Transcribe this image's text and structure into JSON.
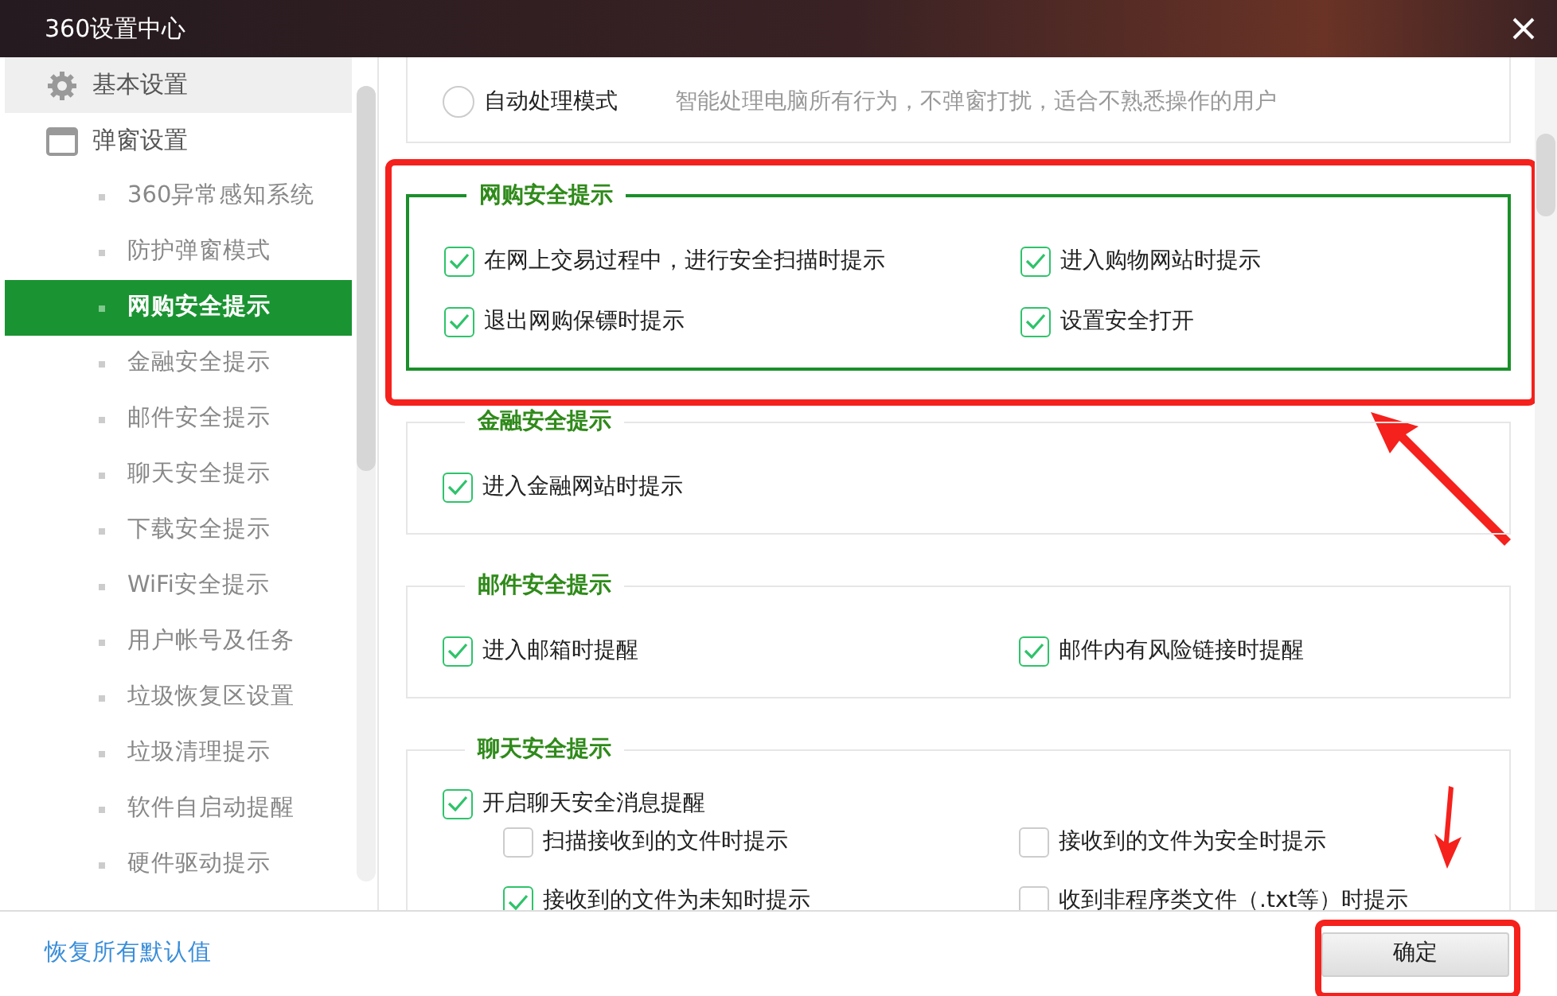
{
  "window": {
    "title": "360设置中心"
  },
  "sidebar": {
    "items": [
      {
        "label": "基本设置",
        "selected": false,
        "hovered": true
      },
      {
        "label": "弹窗设置",
        "selected": false,
        "hovered": false,
        "children": [
          {
            "label": "360异常感知系统",
            "selected": false
          },
          {
            "label": "防护弹窗模式",
            "selected": false
          },
          {
            "label": "网购安全提示",
            "selected": true
          },
          {
            "label": "金融安全提示",
            "selected": false
          },
          {
            "label": "邮件安全提示",
            "selected": false
          },
          {
            "label": "聊天安全提示",
            "selected": false
          },
          {
            "label": "下载安全提示",
            "selected": false
          },
          {
            "label": "WiFi安全提示",
            "selected": false
          },
          {
            "label": "用户帐号及任务",
            "selected": false
          },
          {
            "label": "垃圾恢复区设置",
            "selected": false
          },
          {
            "label": "垃圾清理提示",
            "selected": false
          },
          {
            "label": "软件自启动提醒",
            "selected": false
          },
          {
            "label": "硬件驱动提示",
            "selected": false
          }
        ]
      }
    ]
  },
  "sections": [
    {
      "highlighted": false,
      "options": [
        {
          "kind": "radio",
          "label": "自动处理模式",
          "selected": false,
          "description": "智能处理电脑所有行为，不弹窗打扰，适合不熟悉操作的用户"
        }
      ]
    },
    {
      "legend": "网购安全提示",
      "highlighted": true,
      "options": [
        {
          "kind": "checkbox",
          "label": "在网上交易过程中，进行安全扫描时提示",
          "checked": true
        },
        {
          "kind": "checkbox",
          "label": "进入购物网站时提示",
          "checked": true
        },
        {
          "kind": "checkbox",
          "label": "退出网购保镖时提示",
          "checked": true
        },
        {
          "kind": "checkbox",
          "label": "设置安全打开",
          "checked": true
        }
      ]
    },
    {
      "legend": "金融安全提示",
      "highlighted": false,
      "options": [
        {
          "kind": "checkbox",
          "label": "进入金融网站时提示",
          "checked": true
        }
      ]
    },
    {
      "legend": "邮件安全提示",
      "highlighted": false,
      "options": [
        {
          "kind": "checkbox",
          "label": "进入邮箱时提醒",
          "checked": true
        },
        {
          "kind": "checkbox",
          "label": "邮件内有风险链接时提醒",
          "checked": true
        }
      ]
    },
    {
      "legend": "聊天安全提示",
      "highlighted": false,
      "options": [
        {
          "kind": "checkbox",
          "label": "开启聊天安全消息提醒",
          "checked": true,
          "children": [
            {
              "kind": "checkbox",
              "label": "扫描接收到的文件时提示",
              "checked": false
            },
            {
              "kind": "checkbox",
              "label": "接收到的文件为安全时提示",
              "checked": false
            },
            {
              "kind": "checkbox",
              "label": "接收到的文件为未知时提示",
              "checked": true
            },
            {
              "kind": "checkbox",
              "label": "收到非程序类文件（.txt等）时提示",
              "checked": false
            }
          ]
        }
      ]
    }
  ],
  "footer": {
    "reset_link": "恢复所有默认值",
    "confirm_button": {
      "label": "确定",
      "highlighted": true
    }
  }
}
